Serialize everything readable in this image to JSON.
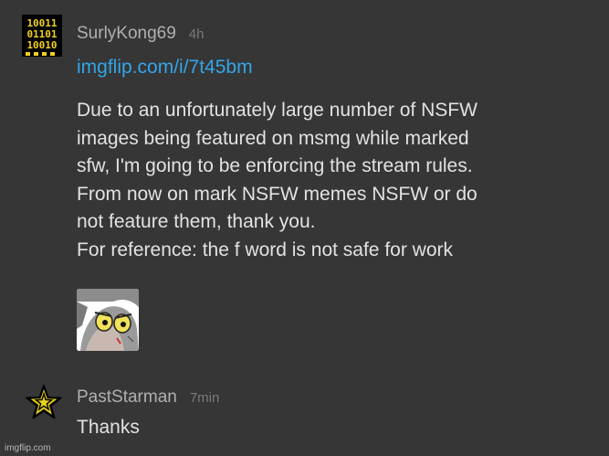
{
  "comments": [
    {
      "username": "SurlyKong69",
      "time": "4h",
      "link": "imgflip.com/i/7t45bm",
      "lines": [
        "Due to an unfortunately large number of NSFW",
        "images being featured on msmg while marked",
        "sfw, I'm going to be enforcing the stream rules.",
        "From now on mark NSFW memes NSFW or do",
        "not feature them, thank you.",
        "For reference: the f word is not safe for work"
      ],
      "avatar_icon": "binary-code-icon",
      "avatar_colors": {
        "background": "#000000",
        "digits": "#f0d020"
      },
      "binary_rows": [
        "10011",
        "01101",
        "10010"
      ],
      "thumbnail_icon": "unsettled-tom-meme-thumbnail"
    },
    {
      "username": "PastStarman",
      "time": "7min",
      "text": "Thanks",
      "avatar_icon": "star-icon",
      "avatar_colors": {
        "fill": "#e8d21a",
        "outline": "#000000"
      }
    }
  ],
  "watermark": "imgflip.com",
  "colors": {
    "background": "#363636",
    "link": "#33a5e8",
    "text": "#e2e2e2",
    "username": "#b0b0b0",
    "time": "#7a7a7a"
  }
}
